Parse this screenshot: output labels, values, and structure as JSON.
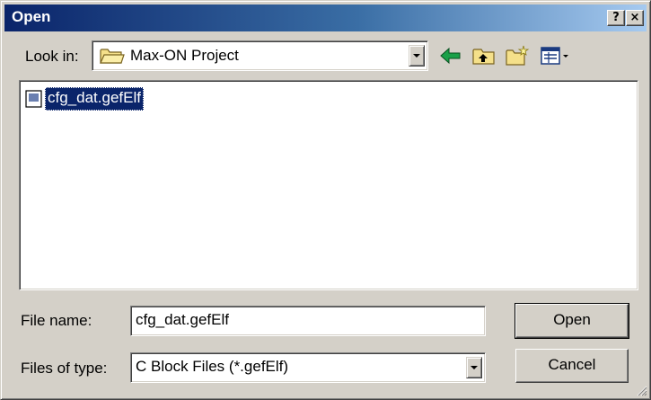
{
  "window": {
    "title": "Open",
    "help_label": "?",
    "close_label": "×"
  },
  "lookin": {
    "label": "Look in:",
    "value": "Max-ON Project",
    "icon": "folder-icon"
  },
  "toolbar": {
    "icons": [
      "back-arrow-icon",
      "up-one-level-icon",
      "new-folder-icon",
      "view-menu-icon"
    ]
  },
  "files": [
    {
      "name": "cfg_dat.gefElf",
      "selected": true,
      "icon": "file-icon"
    }
  ],
  "filename": {
    "label": "File name:",
    "value": "cfg_dat.gefElf"
  },
  "filetype": {
    "label": "Files of type:",
    "value": "C Block Files (*.gefElf)"
  },
  "buttons": {
    "open": "Open",
    "cancel": "Cancel"
  },
  "colors": {
    "title_start": "#0a246a",
    "title_end": "#a6caf0",
    "face": "#d4d0c8",
    "selection": "#0a246a"
  }
}
